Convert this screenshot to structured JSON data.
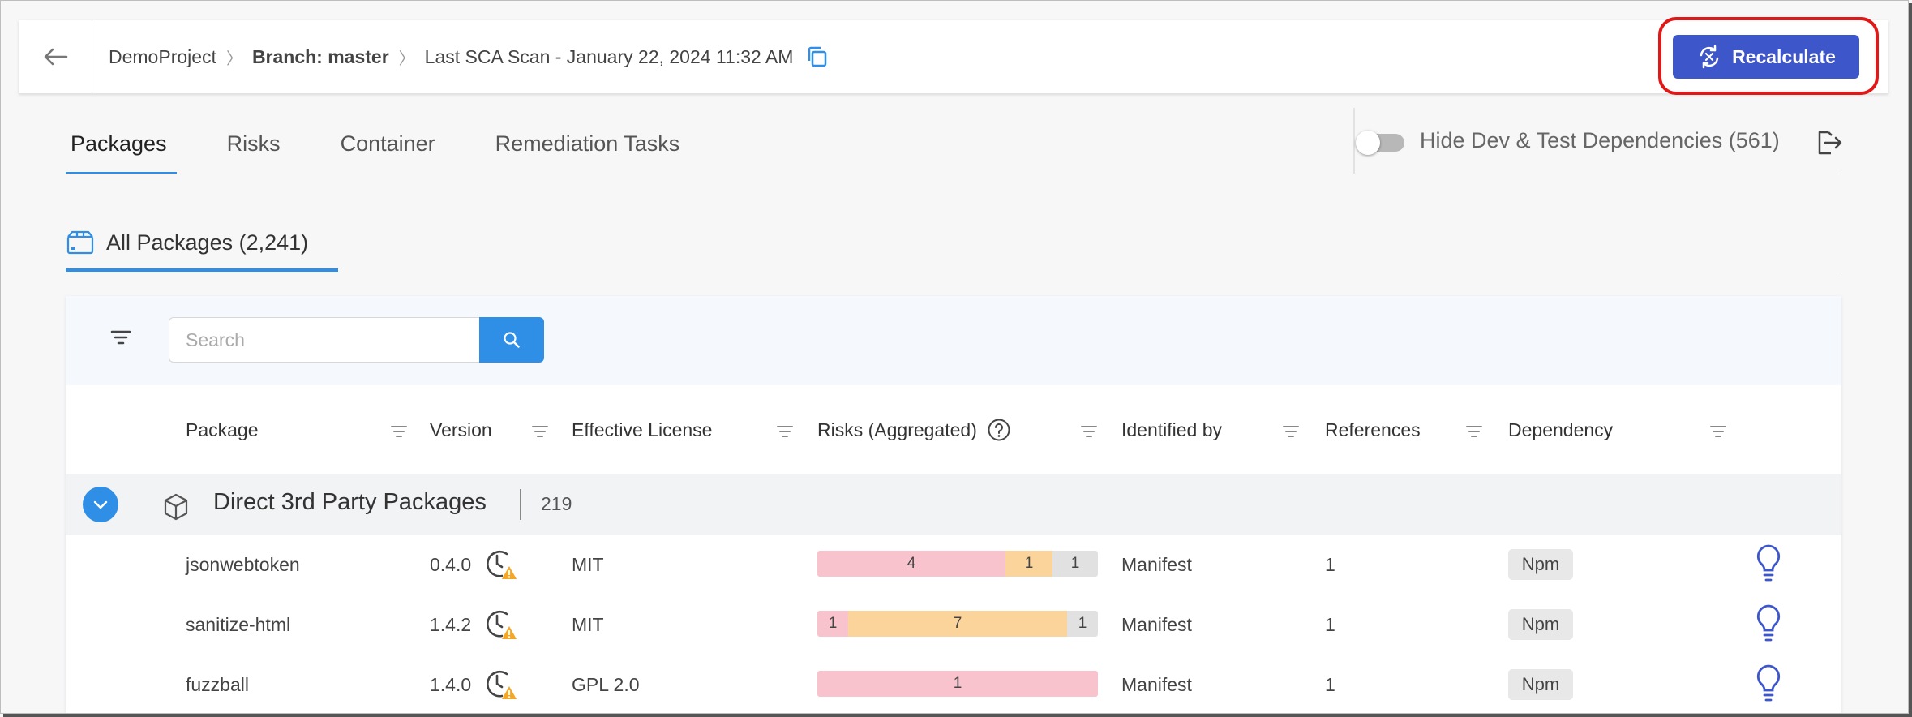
{
  "header": {
    "project": "DemoProject",
    "branch": "Branch: master",
    "scan": "Last SCA Scan - January 22, 2024 11:32 AM",
    "recalculate_label": "Recalculate"
  },
  "tabs": [
    {
      "label": "Packages",
      "active": true
    },
    {
      "label": "Risks"
    },
    {
      "label": "Container"
    },
    {
      "label": "Remediation Tasks"
    }
  ],
  "hide_dev_label": "Hide Dev & Test Dependencies (561)",
  "subtab": {
    "label": "All Packages (2,241)"
  },
  "search": {
    "placeholder": "Search",
    "value": ""
  },
  "columns": [
    "Package",
    "Version",
    "Effective License",
    "Risks (Aggregated)",
    "Identified by",
    "References",
    "Dependency"
  ],
  "group": {
    "title": "Direct 3rd Party Packages",
    "count": "219"
  },
  "rows": [
    {
      "package": "jsonwebtoken",
      "version": "0.4.0",
      "license": "MIT",
      "risks": {
        "high": "4",
        "medium": "1",
        "low": "1"
      },
      "identified_by": "Manifest",
      "references": "1",
      "dependency": "Npm"
    },
    {
      "package": "sanitize-html",
      "version": "1.4.2",
      "license": "MIT",
      "risks": {
        "high": "1",
        "medium": "7",
        "low": "1"
      },
      "identified_by": "Manifest",
      "references": "1",
      "dependency": "Npm"
    },
    {
      "package": "fuzzball",
      "version": "1.4.0",
      "license": "GPL 2.0",
      "risks": {
        "high": "1"
      },
      "identified_by": "Manifest",
      "references": "1",
      "dependency": "Npm"
    }
  ],
  "colors": {
    "accent": "#2f8ee6",
    "recalculate": "#3d56c9",
    "highlight_ring": "#e01818",
    "risk_high": "#f8c3cc",
    "risk_medium": "#fbd49b",
    "risk_low": "#e1e1e1",
    "warning": "#f5a623"
  }
}
